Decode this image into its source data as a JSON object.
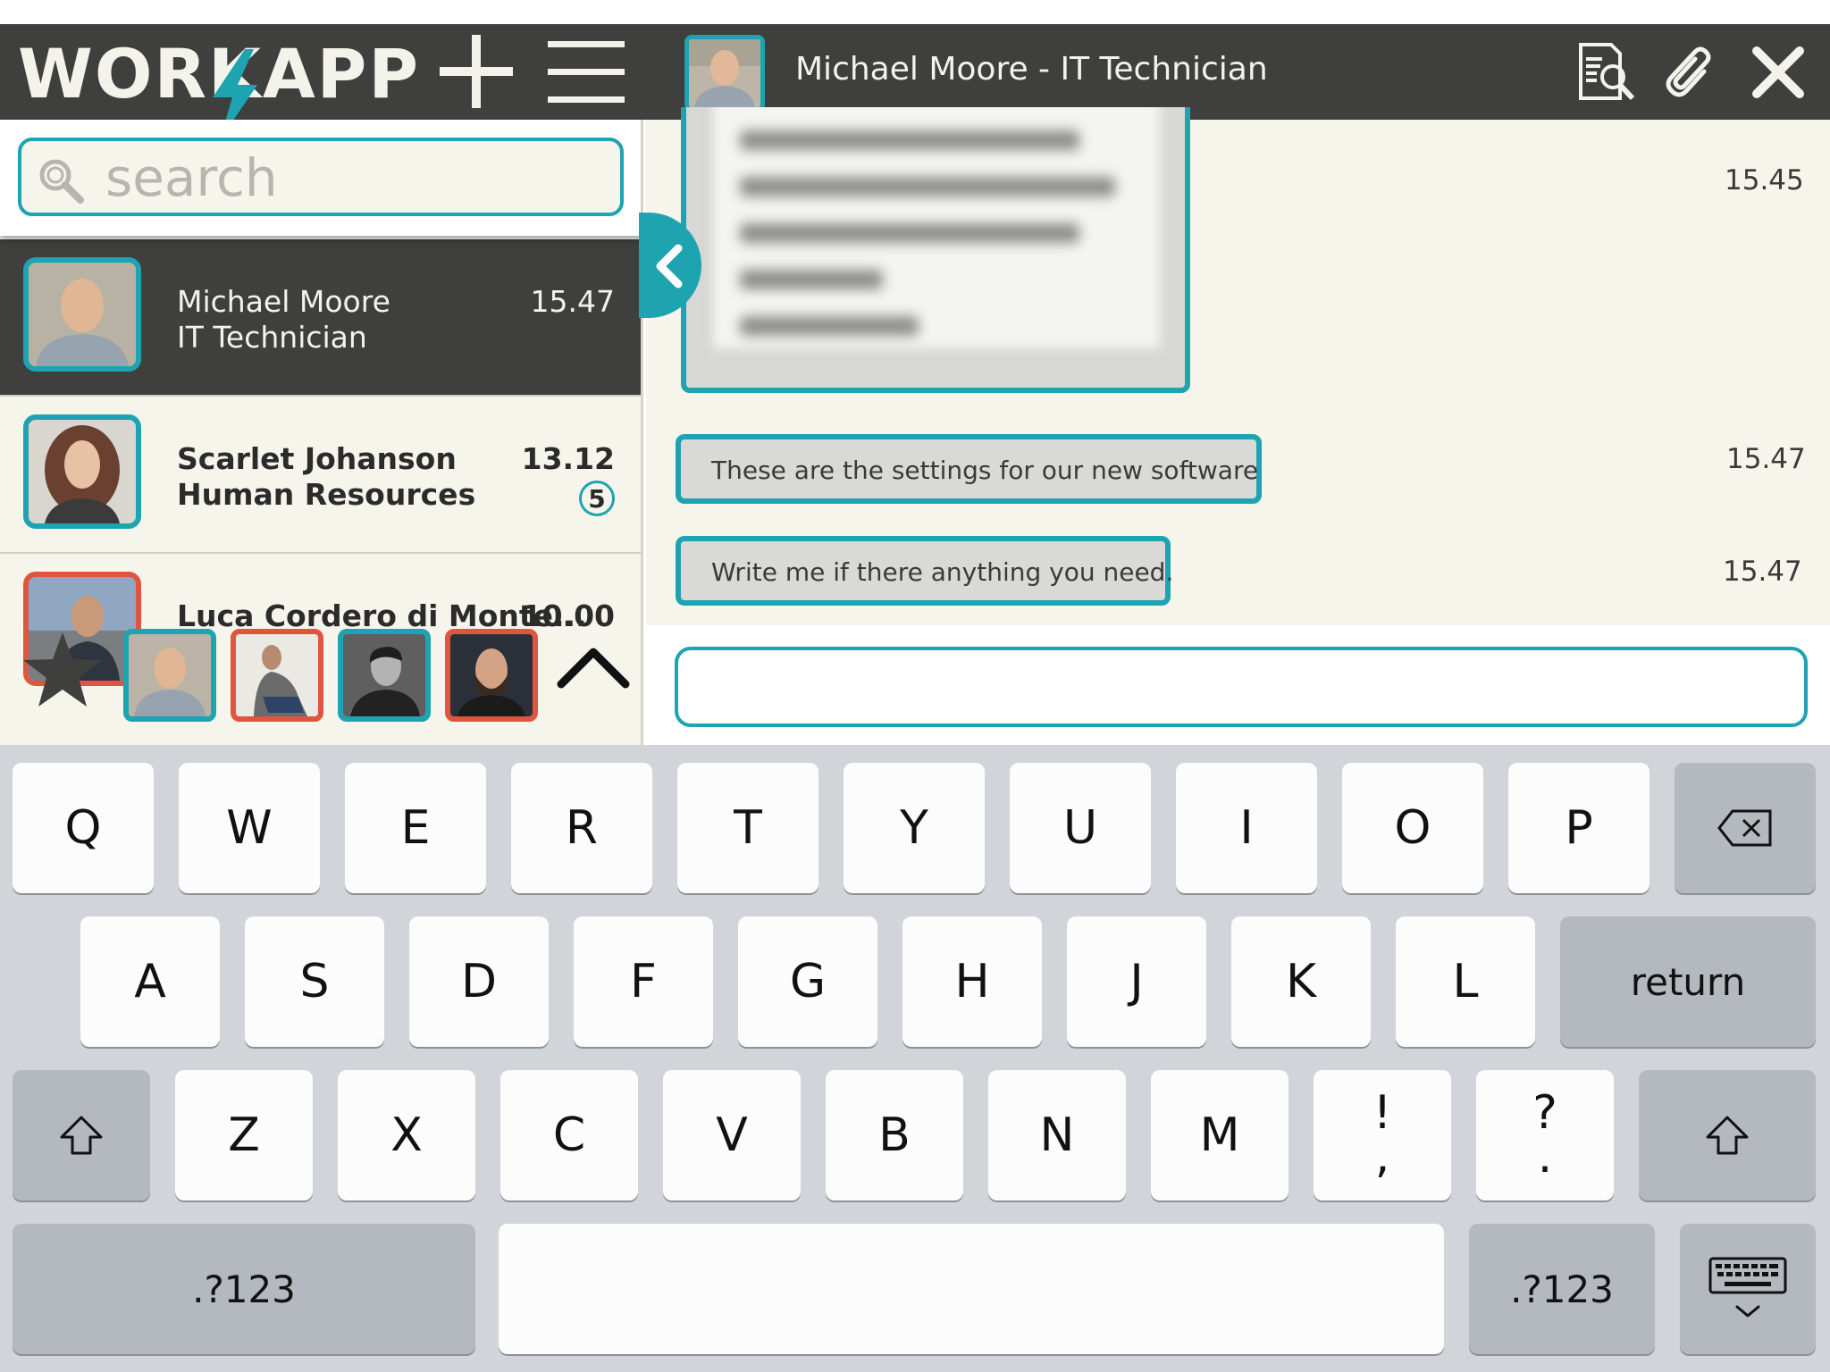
{
  "app": {
    "logo_text": "WORKAPP"
  },
  "header": {
    "chat_title": "Michael Moore - IT Technician",
    "icons": [
      "add-icon",
      "menu-icon",
      "document-search-icon",
      "paperclip-icon",
      "close-icon"
    ]
  },
  "search": {
    "placeholder": "search",
    "value": ""
  },
  "conversations": [
    {
      "name": "Michael Moore",
      "role": "IT Technician",
      "time": "15.47",
      "unread": "",
      "selected": true
    },
    {
      "name": "Scarlet Johanson",
      "role": "Human Resources",
      "time": "13.12",
      "unread": "5",
      "selected": false
    },
    {
      "name": "Luca Cordero di Monte...",
      "role": "",
      "time": "10.00",
      "unread": "",
      "selected": false
    }
  ],
  "favorites": {
    "count": 4,
    "icons": [
      "star-icon",
      "chevron-up-icon"
    ]
  },
  "chat": {
    "messages": [
      {
        "type": "image",
        "time": "15.45"
      },
      {
        "type": "text",
        "text": "These are the settings for our new software",
        "time": "15.47"
      },
      {
        "type": "text",
        "text": "Write me if there anything you need.",
        "time": "15.47"
      }
    ],
    "compose": {
      "placeholder": "",
      "value": ""
    }
  },
  "keyboard": {
    "row1": [
      "Q",
      "W",
      "E",
      "R",
      "T",
      "Y",
      "U",
      "I",
      "O",
      "P"
    ],
    "row2": [
      "A",
      "S",
      "D",
      "F",
      "G",
      "H",
      "J",
      "K",
      "L"
    ],
    "row3": [
      "Z",
      "X",
      "C",
      "V",
      "B",
      "N",
      "M"
    ],
    "punct1": [
      "!",
      ","
    ],
    "punct2": [
      "?",
      "."
    ],
    "return_label": "return",
    "numbers_label": ".?123",
    "icons": [
      "backspace-icon",
      "shift-icon",
      "hide-keyboard-icon"
    ]
  },
  "colors": {
    "accent": "#1ea3b0",
    "header": "#3f3f3e",
    "background": "#f6f5ec",
    "alert": "#e0553f"
  }
}
